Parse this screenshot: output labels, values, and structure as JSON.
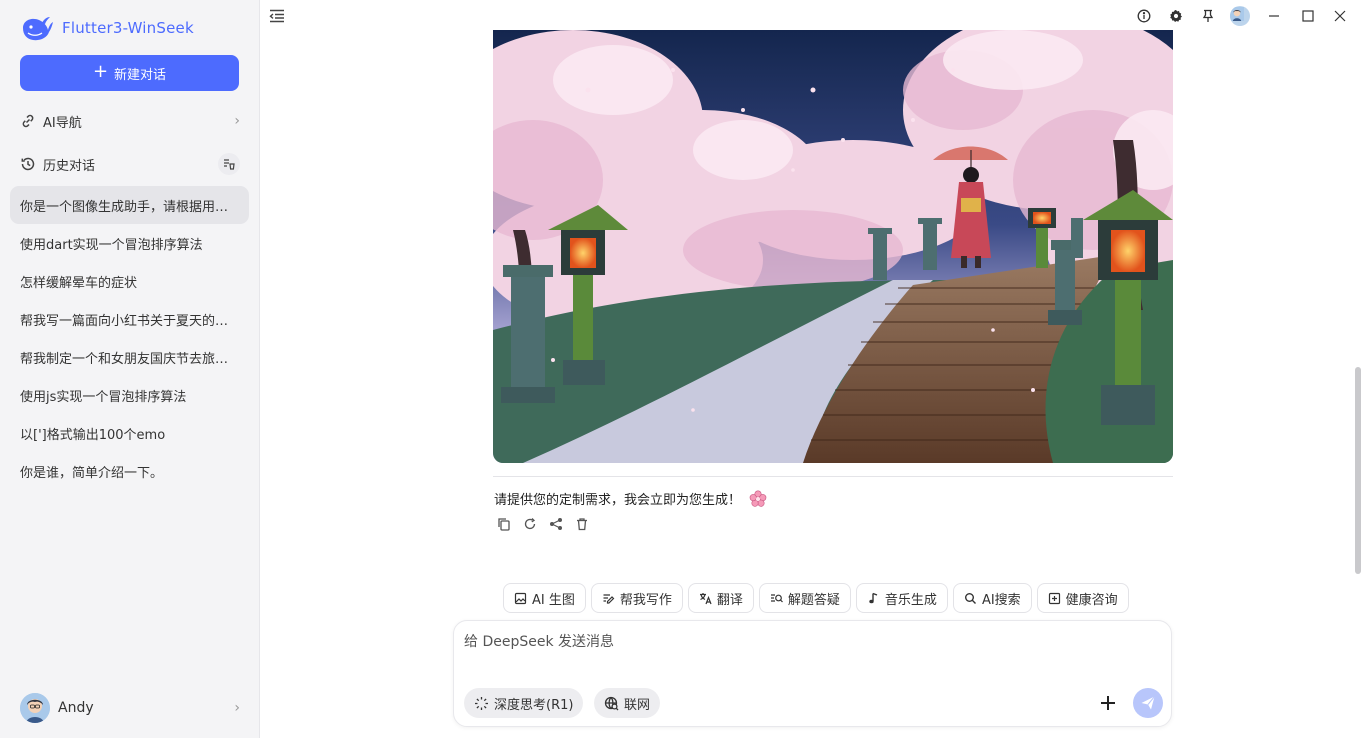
{
  "app": {
    "name": "Flutter3-WinSeek",
    "logo_icon": "whale-logo-icon",
    "accent_color": "#4d6bfe"
  },
  "sidebar": {
    "new_chat_label": "新建对话",
    "nav_label": "AI导航",
    "history_label": "历史对话",
    "history": [
      "你是一个图像生成助手，请根据用户提供的描述生成图片",
      "使用dart实现一个冒泡排序算法",
      "怎样缓解晕车的症状",
      "帮我写一篇面向小红书关于夏天的文案",
      "帮我制定一个和女朋友国庆节去旅行的计划",
      "使用js实现一个冒泡排序算法",
      "以[']格式输出100个emo",
      "你是谁，简单介绍一下。"
    ],
    "active_history_index": 0,
    "user_name": "Andy"
  },
  "window_controls": [
    "info-icon",
    "settings-icon",
    "pin-icon",
    "avatar",
    "minimize-icon",
    "maximize-icon",
    "close-icon"
  ],
  "message": {
    "image_description_icon": "generated-image",
    "reply_text": "请提供您的定制需求，我会立即为您生成！",
    "reply_emoji_icon": "cherry-blossom-icon",
    "actions": [
      "copy-icon",
      "regenerate-icon",
      "share-icon",
      "delete-icon"
    ]
  },
  "quick_tools": [
    {
      "icon": "image-icon",
      "label": "AI 生图"
    },
    {
      "icon": "write-icon",
      "label": "帮我写作"
    },
    {
      "icon": "translate-icon",
      "label": "翻译"
    },
    {
      "icon": "qa-icon",
      "label": "解题答疑"
    },
    {
      "icon": "music-icon",
      "label": "音乐生成"
    },
    {
      "icon": "search-icon",
      "label": "AI搜索"
    },
    {
      "icon": "health-icon",
      "label": "健康咨询"
    }
  ],
  "composer": {
    "placeholder": "给 DeepSeek 发送消息",
    "value": "",
    "deep_think_label": "深度思考(R1)",
    "web_label": "联网"
  }
}
